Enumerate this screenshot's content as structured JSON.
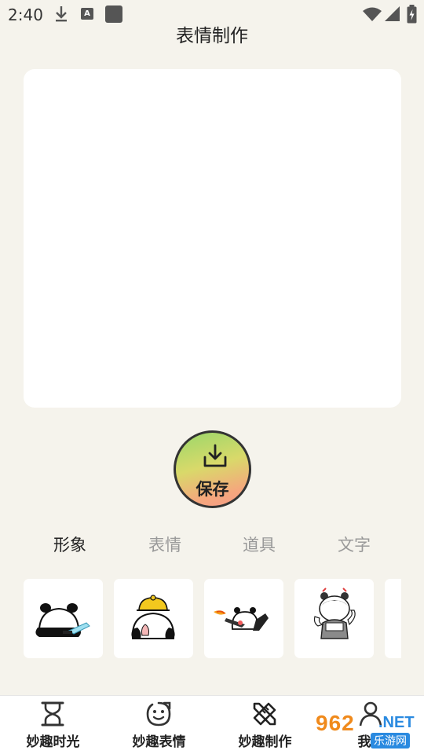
{
  "status_bar": {
    "time": "2:40",
    "icons": [
      "download-icon",
      "a-badge-icon",
      "square-icon",
      "wifi-icon",
      "signal-icon",
      "battery-charging-icon"
    ],
    "a_badge": "A"
  },
  "page": {
    "title": "表情制作"
  },
  "save": {
    "label": "保存"
  },
  "tabs": [
    {
      "label": "形象",
      "active": true
    },
    {
      "label": "表情",
      "active": false
    },
    {
      "label": "道具",
      "active": false
    },
    {
      "label": "文字",
      "active": false
    }
  ],
  "stickers": [
    "panda-knife",
    "panda-hardhat",
    "panda-gun",
    "girl-buns"
  ],
  "bottom_nav": [
    {
      "label": "妙趣时光",
      "icon": "hourglass-icon"
    },
    {
      "label": "妙趣表情",
      "icon": "smiley-icon"
    },
    {
      "label": "妙趣制作",
      "icon": "pencil-ruler-icon"
    },
    {
      "label": "我的",
      "icon": "user-icon"
    }
  ],
  "watermark": {
    "big": "962",
    "net": ".NET",
    "small": "乐游网"
  },
  "colors": {
    "background": "#f5f3ec",
    "active_tab": "#222222",
    "inactive_tab": "#999999"
  }
}
